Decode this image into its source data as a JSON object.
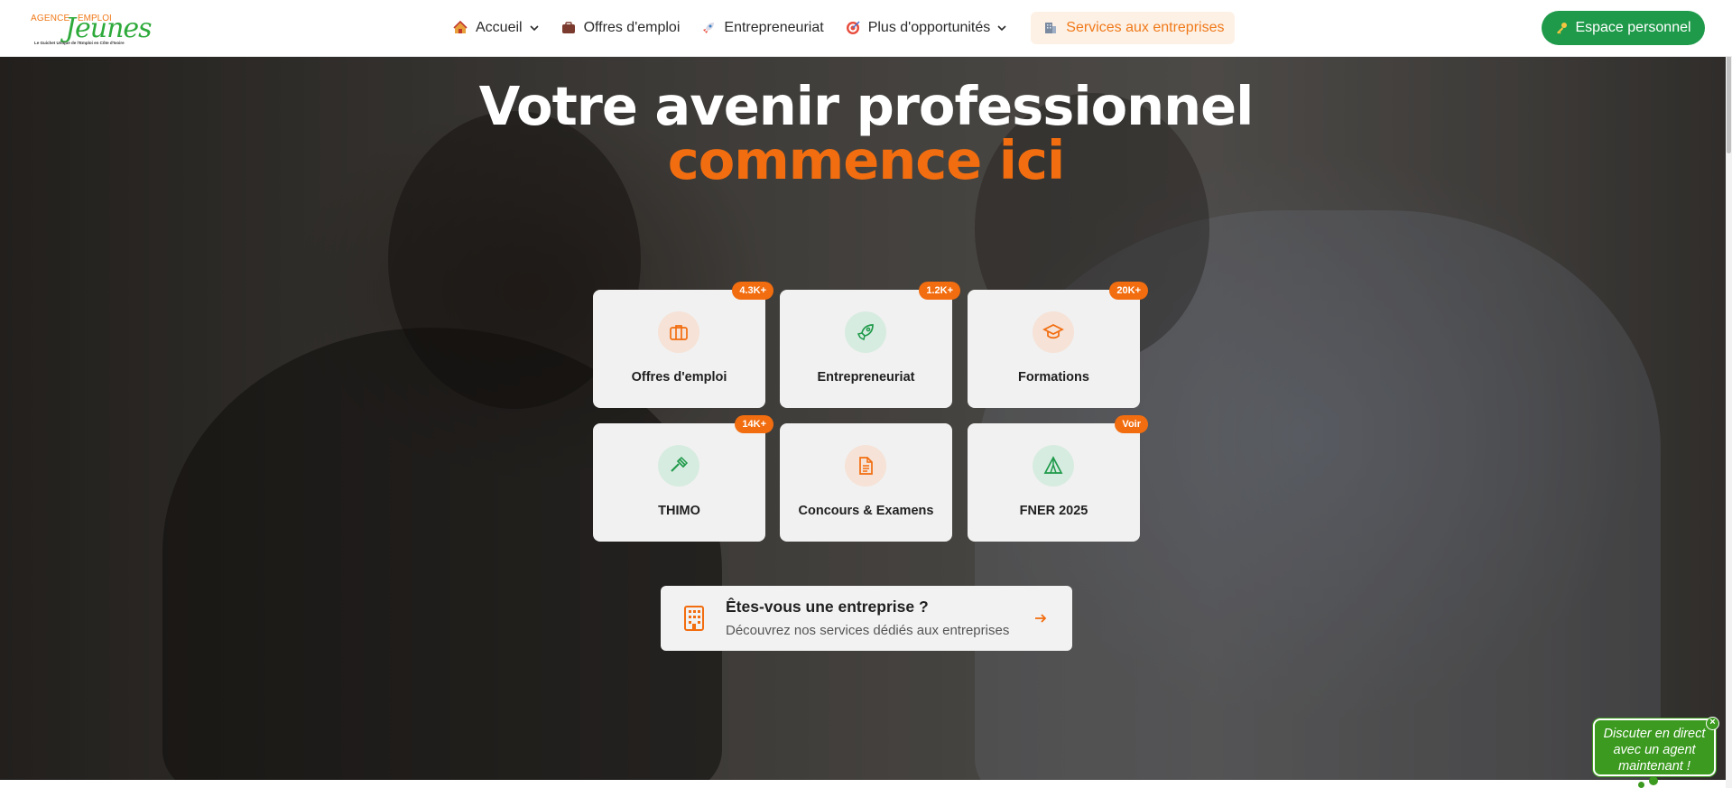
{
  "logo": {
    "word1": "AGENCE",
    "word2": "EMPLOI",
    "main": "Jeunes",
    "tagline": "Le Guichet Unique de l'Emploi en Côte d'Ivoire"
  },
  "nav": {
    "items": [
      {
        "label": "Accueil",
        "icon": "home-icon",
        "has_dropdown": true
      },
      {
        "label": "Offres d'emploi",
        "icon": "briefcase-icon",
        "has_dropdown": false
      },
      {
        "label": "Entrepreneuriat",
        "icon": "rocket-icon",
        "has_dropdown": false
      },
      {
        "label": "Plus d'opportunités",
        "icon": "target-icon",
        "has_dropdown": true
      },
      {
        "label": "Services aux entreprises",
        "icon": "building-icon",
        "has_dropdown": false
      }
    ],
    "espace_button": "Espace personnel"
  },
  "hero": {
    "title_line1": "Votre avenir professionnel",
    "title_line2": "commence ici"
  },
  "cards": [
    {
      "label": "Offres d'emploi",
      "badge": "4.3K+",
      "icon": "briefcase-icon",
      "tone": "orange"
    },
    {
      "label": "Entrepreneuriat",
      "badge": "1.2K+",
      "icon": "rocket-icon",
      "tone": "green"
    },
    {
      "label": "Formations",
      "badge": "20K+",
      "icon": "graduation-cap-icon",
      "tone": "orange"
    },
    {
      "label": "THIMO",
      "badge": "14K+",
      "icon": "hammer-icon",
      "tone": "green"
    },
    {
      "label": "Concours & Examens",
      "badge": "",
      "icon": "document-icon",
      "tone": "orange"
    },
    {
      "label": "FNER 2025",
      "badge": "Voir",
      "icon": "tent-icon",
      "tone": "green"
    }
  ],
  "enterprise": {
    "title": "Êtes-vous une entreprise ?",
    "subtitle": "Découvrez nos services dédiés aux entreprises"
  },
  "chat": {
    "text": "Discuter en direct avec un agent maintenant !",
    "close": "×"
  },
  "colors": {
    "accent_orange": "#f26d0f",
    "brand_green": "#1f9a4a",
    "chat_green": "#3b9a1f"
  }
}
